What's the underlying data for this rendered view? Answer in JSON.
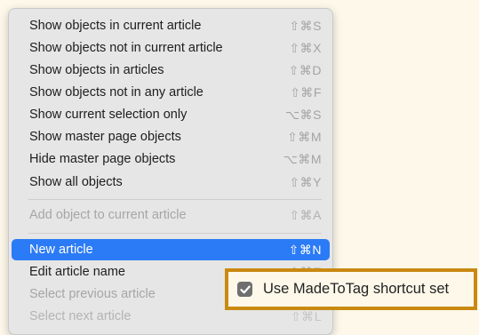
{
  "menu": {
    "items": [
      {
        "label": "Show objects in current article",
        "shortcut": "⇧⌘S"
      },
      {
        "label": "Show objects not in current article",
        "shortcut": "⇧⌘X"
      },
      {
        "label": "Show objects in articles",
        "shortcut": "⇧⌘D"
      },
      {
        "label": "Show objects not in any article",
        "shortcut": "⇧⌘F"
      },
      {
        "label": "Show current selection only",
        "shortcut": "⌥⌘S"
      },
      {
        "label": "Show master page objects",
        "shortcut": "⇧⌘M"
      },
      {
        "label": "Hide master page objects",
        "shortcut": "⌥⌘M"
      },
      {
        "label": "Show all objects",
        "shortcut": "⇧⌘Y"
      },
      {
        "label": "Add object to current article",
        "shortcut": "⇧⌘A"
      },
      {
        "label": "New article",
        "shortcut": "⇧⌘N"
      },
      {
        "label": "Edit article name",
        "shortcut": "⇧⌘E"
      },
      {
        "label": "Select previous article",
        "shortcut": ""
      },
      {
        "label": "Select next article",
        "shortcut": "⇧⌘L"
      }
    ]
  },
  "option": {
    "label": "Use MadeToTag shortcut set",
    "checked": true
  },
  "colors": {
    "highlight": "#2b7bf6",
    "frame": "#c98a12"
  }
}
